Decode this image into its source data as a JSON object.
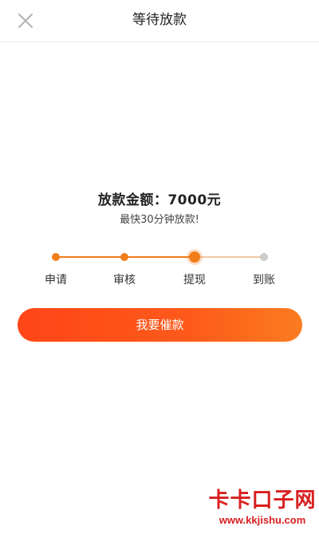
{
  "header": {
    "title": "等待放款",
    "close_icon": "close-icon"
  },
  "amount": {
    "text": "放款金额：7000元",
    "subtitle": "最快30分钟放款!"
  },
  "progress": {
    "steps": [
      {
        "label": "申请",
        "status": "done"
      },
      {
        "label": "审核",
        "status": "done"
      },
      {
        "label": "提现",
        "status": "current"
      },
      {
        "label": "到账",
        "status": "pending"
      }
    ]
  },
  "actions": {
    "urge_label": "我要催款"
  },
  "watermark": {
    "title": "卡卡口子网",
    "url": "www.kkjishu.com"
  },
  "colors": {
    "accent": "#f07d1a",
    "pending": "#cccccc",
    "button_start": "#fe4517",
    "button_end": "#fb7c1f",
    "watermark": "#d81f1f"
  }
}
